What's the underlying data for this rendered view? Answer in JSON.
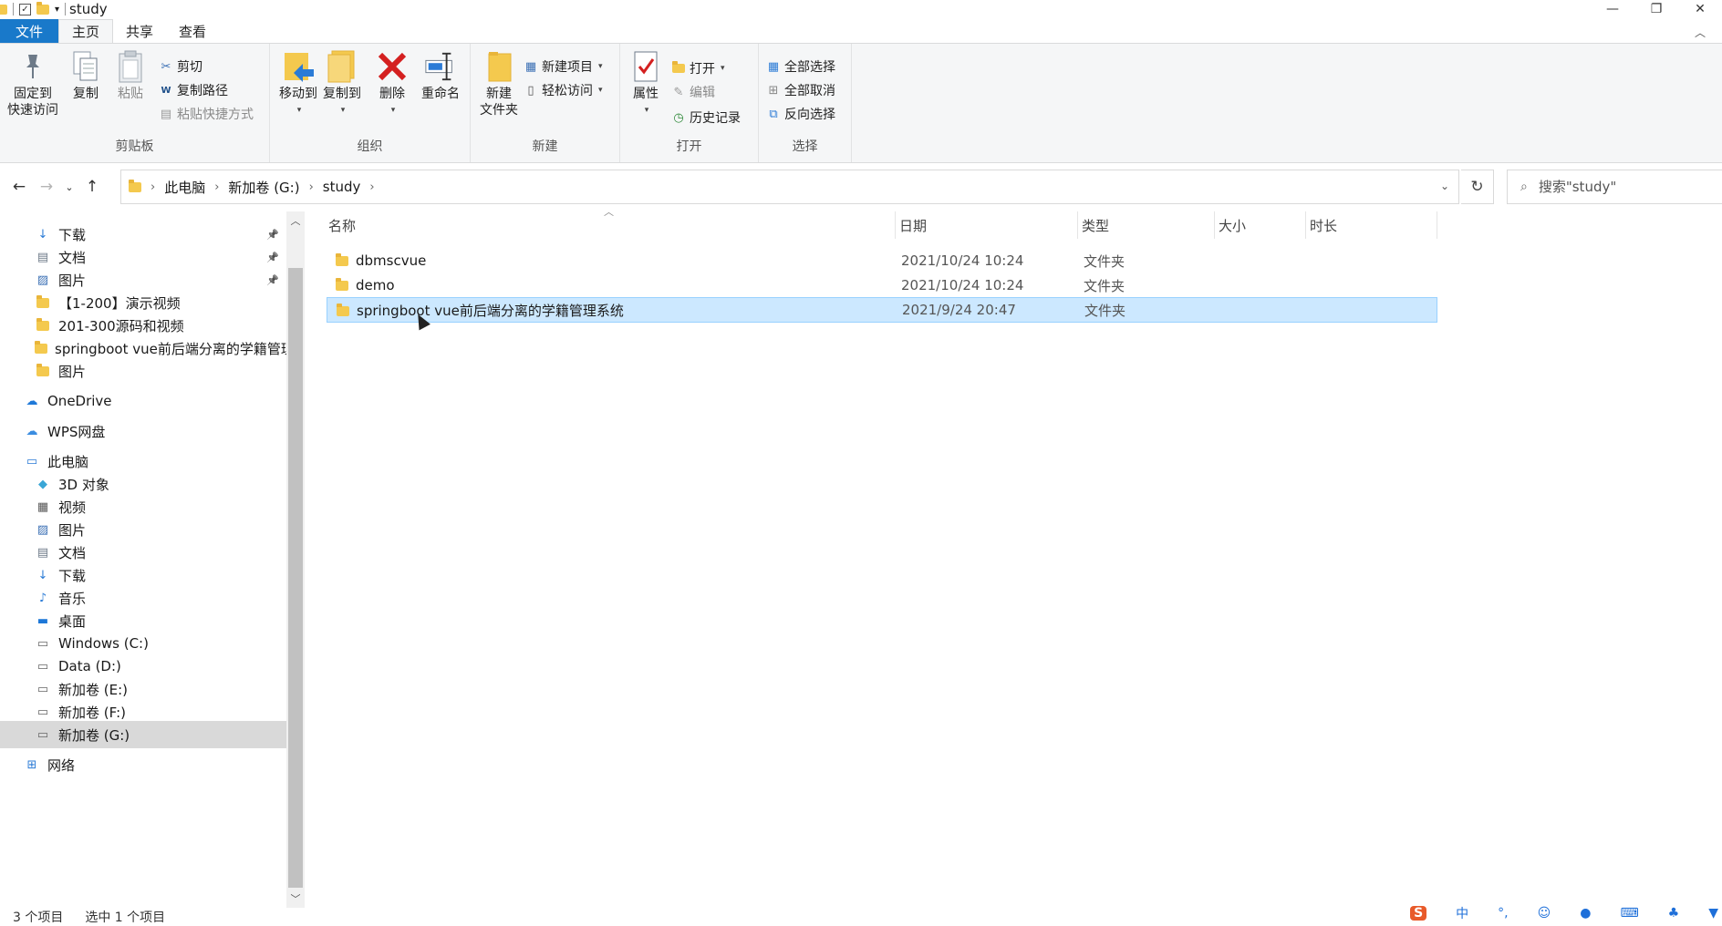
{
  "window": {
    "title": "study",
    "minimize": "—",
    "maximize": "❐",
    "close": "✕"
  },
  "ribbon_tabs": [
    {
      "label": "文件"
    },
    {
      "label": "主页"
    },
    {
      "label": "共享"
    },
    {
      "label": "查看"
    }
  ],
  "ribbon": {
    "clipboard": {
      "label": "剪贴板",
      "pin_line1": "固定到",
      "pin_line2": "快速访问",
      "copy": "复制",
      "paste": "粘贴",
      "cut": "剪切",
      "copy_path": "复制路径",
      "paste_shortcut": "粘贴快捷方式"
    },
    "organize": {
      "label": "组织",
      "move_to": "移动到",
      "copy_to": "复制到",
      "delete": "删除",
      "rename": "重命名"
    },
    "new": {
      "label": "新建",
      "new_folder_line1": "新建",
      "new_folder_line2": "文件夹",
      "new_item": "新建项目",
      "easy_access": "轻松访问"
    },
    "open": {
      "label": "打开",
      "properties": "属性",
      "open": "打开",
      "edit": "编辑",
      "history": "历史记录"
    },
    "select": {
      "label": "选择",
      "select_all": "全部选择",
      "select_none": "全部取消",
      "invert": "反向选择"
    }
  },
  "address": {
    "crumbs": [
      "此电脑",
      "新加卷 (G:)",
      "study"
    ],
    "search_placeholder": "搜索\"study\""
  },
  "nav_pane": {
    "items": [
      {
        "label": "下载",
        "icon": "download-icon",
        "pinned": true
      },
      {
        "label": "文档",
        "icon": "document-icon",
        "pinned": true
      },
      {
        "label": "图片",
        "icon": "picture-icon",
        "pinned": true
      },
      {
        "label": "【1-200】演示视频",
        "icon": "folder-icon",
        "pinned": false
      },
      {
        "label": "201-300源码和视频",
        "icon": "folder-icon",
        "pinned": false
      },
      {
        "label": "springboot vue前后端分离的学籍管理",
        "icon": "folder-icon",
        "pinned": false
      },
      {
        "label": "图片",
        "icon": "folder-icon",
        "pinned": false
      },
      {
        "label": "OneDrive",
        "icon": "onedrive-icon",
        "pinned": false
      },
      {
        "label": "WPS网盘",
        "icon": "wps-cloud-icon",
        "pinned": false
      },
      {
        "label": "此电脑",
        "icon": "this-pc-icon",
        "pinned": false
      },
      {
        "label": "3D 对象",
        "icon": "3d-objects-icon",
        "pinned": false
      },
      {
        "label": "视频",
        "icon": "video-icon",
        "pinned": false
      },
      {
        "label": "图片",
        "icon": "picture-icon",
        "pinned": false
      },
      {
        "label": "文档",
        "icon": "document-icon",
        "pinned": false
      },
      {
        "label": "下载",
        "icon": "download-icon",
        "pinned": false
      },
      {
        "label": "音乐",
        "icon": "music-icon",
        "pinned": false
      },
      {
        "label": "桌面",
        "icon": "desktop-icon",
        "pinned": false
      },
      {
        "label": "Windows (C:)",
        "icon": "drive-icon",
        "pinned": false
      },
      {
        "label": "Data (D:)",
        "icon": "drive-icon",
        "pinned": false
      },
      {
        "label": "新加卷 (E:)",
        "icon": "drive-icon",
        "pinned": false
      },
      {
        "label": "新加卷 (F:)",
        "icon": "drive-icon",
        "pinned": false
      },
      {
        "label": "新加卷 (G:)",
        "icon": "drive-icon",
        "pinned": false
      },
      {
        "label": "网络",
        "icon": "network-icon",
        "pinned": false
      }
    ]
  },
  "file_list": {
    "columns": [
      "名称",
      "日期",
      "类型",
      "大小",
      "时长"
    ],
    "rows": [
      {
        "name": "dbmscvue",
        "date": "2021/10/24 10:24",
        "type": "文件夹",
        "selected": false
      },
      {
        "name": "demo",
        "date": "2021/10/24 10:24",
        "type": "文件夹",
        "selected": false
      },
      {
        "name": "springboot vue前后端分离的学籍管理系统",
        "date": "2021/9/24 20:47",
        "type": "文件夹",
        "selected": true
      }
    ]
  },
  "status_bar": {
    "item_count": "3 个项目",
    "selected_count": "选中 1 个项目",
    "ime_label": "中"
  },
  "colors": {
    "file_tab": "#1979ca",
    "selection": "#cce8ff",
    "folder": "#f4c94e",
    "delete_red": "#d42020"
  }
}
